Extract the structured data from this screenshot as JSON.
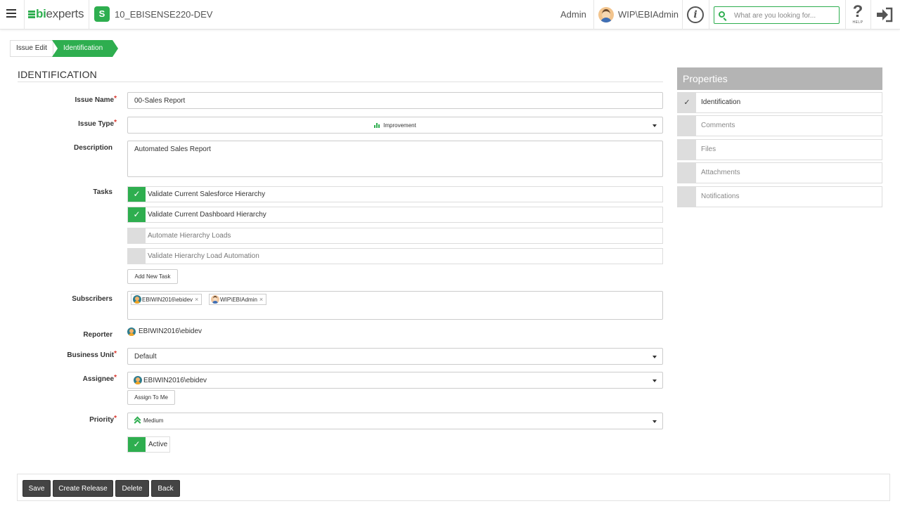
{
  "header": {
    "logo_prefix": "bi",
    "logo_suffix": "experts",
    "app_icon_letter": "S",
    "app_name": "10_EBISENSE220-DEV",
    "admin_label": "Admin",
    "user_label": "WIP\\EBIAdmin",
    "search_placeholder": "What are you looking for...",
    "help_text": "HELP",
    "brand_color": "#2eae4f"
  },
  "breadcrumb": {
    "items": [
      "Issue Edit",
      "Identification"
    ]
  },
  "section_title": "IDENTIFICATION",
  "form": {
    "issue_name": {
      "label": "Issue Name",
      "value": "00-Sales Report"
    },
    "issue_type": {
      "label": "Issue Type",
      "value": "Improvement"
    },
    "description": {
      "label": "Description",
      "value": "Automated Sales Report"
    },
    "tasks": {
      "label": "Tasks",
      "items": [
        {
          "text": "Validate Current Salesforce Hierarchy",
          "done": true
        },
        {
          "text": "Validate Current Dashboard Hierarchy",
          "done": true
        },
        {
          "text": "Automate Hierarchy Loads",
          "done": false
        },
        {
          "text": "Validate Hierarchy Load Automation",
          "done": false
        }
      ],
      "add_button": "Add New Task",
      "check_glyph": "✓"
    },
    "subscribers": {
      "label": "Subscribers",
      "chips": [
        "EBIWIN2016\\ebidev",
        "WIP\\EBIAdmin"
      ],
      "remove_glyph": "×"
    },
    "reporter": {
      "label": "Reporter",
      "value": "EBIWIN2016\\ebidev"
    },
    "business_unit": {
      "label": "Business Unit",
      "value": "Default"
    },
    "assignee": {
      "label": "Assignee",
      "value": "EBIWIN2016\\ebidev",
      "assign_button": "Assign To Me"
    },
    "priority": {
      "label": "Priority",
      "value": "Medium"
    },
    "active": {
      "label": "Active",
      "checked": true
    },
    "required_mark": "*"
  },
  "actions": {
    "save": "Save",
    "create_release": "Create Release",
    "delete": "Delete",
    "back": "Back"
  },
  "properties": {
    "title": "Properties",
    "items": [
      {
        "label": "Identification",
        "selected": true
      },
      {
        "label": "Comments",
        "selected": false
      },
      {
        "label": "Files",
        "selected": false
      },
      {
        "label": "Attachments",
        "selected": false
      },
      {
        "label": "Notifications",
        "selected": false
      }
    ]
  }
}
